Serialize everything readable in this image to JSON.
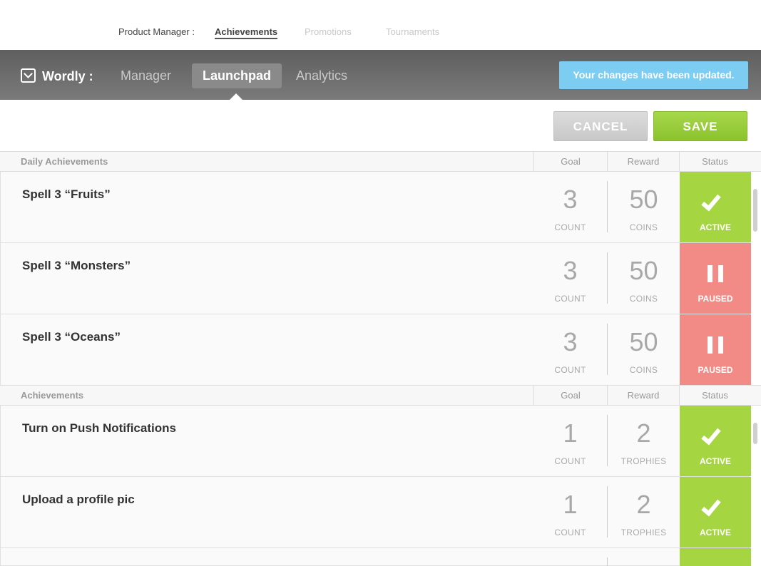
{
  "product_manager": {
    "label": "Product Manager :",
    "tabs": [
      "Achievements",
      "Promotions",
      "Tournaments"
    ]
  },
  "app": {
    "brand": "Wordly :",
    "nav": [
      "Manager",
      "Launchpad",
      "Analytics"
    ],
    "notice": "Your changes have been updated."
  },
  "actions": {
    "cancel": "CANCEL",
    "save": "SAVE"
  },
  "columns": {
    "goal": "Goal",
    "reward": "Reward",
    "status": "Status"
  },
  "daily": {
    "title": "Daily Achievements",
    "rows": [
      {
        "name": "Spell 3 “Fruits”",
        "goal": "3",
        "goal_unit": "COUNT",
        "reward": "50",
        "reward_unit": "COINS",
        "status": "ACTIVE"
      },
      {
        "name": "Spell 3 “Monsters”",
        "goal": "3",
        "goal_unit": "COUNT",
        "reward": "50",
        "reward_unit": "COINS",
        "status": "PAUSED"
      },
      {
        "name": "Spell 3 “Oceans”",
        "goal": "3",
        "goal_unit": "COUNT",
        "reward": "50",
        "reward_unit": "COINS",
        "status": "PAUSED"
      }
    ]
  },
  "achievements": {
    "title": "Achievements",
    "rows": [
      {
        "name": "Turn on Push Notifications",
        "goal": "1",
        "goal_unit": "COUNT",
        "reward": "2",
        "reward_unit": "TROPHIES",
        "status": "ACTIVE"
      },
      {
        "name": "Upload a profile pic",
        "goal": "1",
        "goal_unit": "COUNT",
        "reward": "2",
        "reward_unit": "TROPHIES",
        "status": "ACTIVE"
      }
    ]
  },
  "colors": {
    "active": "#a5d641",
    "paused": "#f28b86",
    "notice": "#7ccdf1",
    "save": "#94c936"
  }
}
